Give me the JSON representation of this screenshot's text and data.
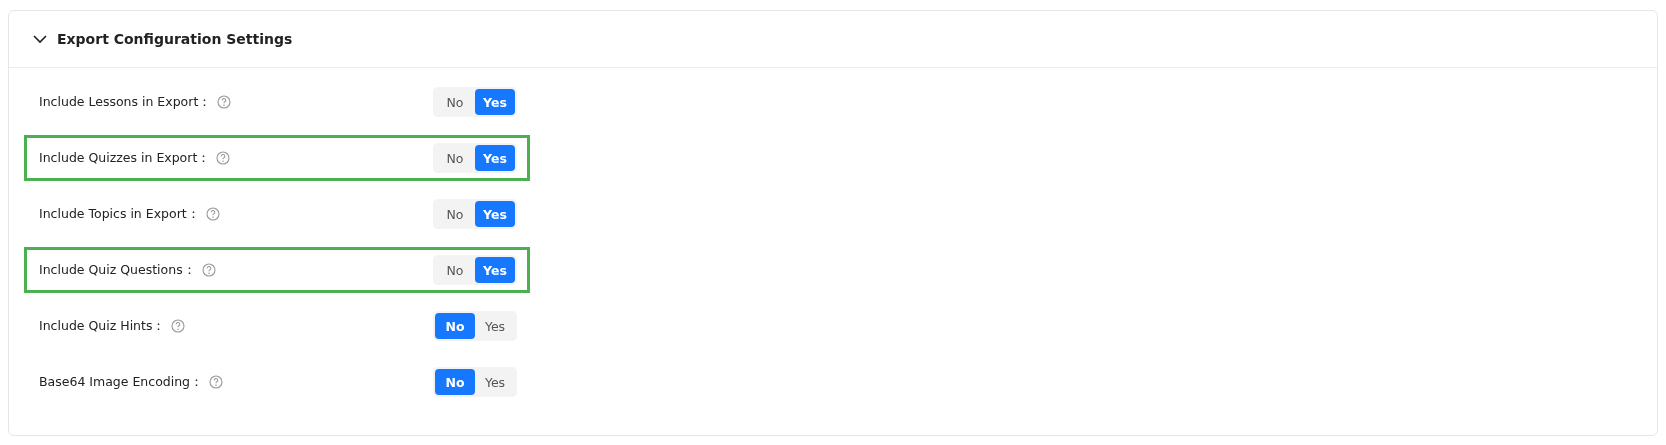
{
  "panel": {
    "title": "Export Configuration Settings",
    "expanded": true,
    "rows": [
      {
        "label": "Include Lessons in Export：",
        "highlighted": false,
        "options": [
          {
            "label": "No",
            "selected": false
          },
          {
            "label": "Yes",
            "selected": true
          }
        ]
      },
      {
        "label": "Include Quizzes in Export：",
        "highlighted": true,
        "options": [
          {
            "label": "No",
            "selected": false
          },
          {
            "label": "Yes",
            "selected": true
          }
        ]
      },
      {
        "label": "Include Topics in Export：",
        "highlighted": false,
        "options": [
          {
            "label": "No",
            "selected": false
          },
          {
            "label": "Yes",
            "selected": true
          }
        ]
      },
      {
        "label": "Include Quiz Questions：",
        "highlighted": true,
        "options": [
          {
            "label": "No",
            "selected": false
          },
          {
            "label": "Yes",
            "selected": true
          }
        ]
      },
      {
        "label": "Include Quiz Hints：",
        "highlighted": false,
        "options": [
          {
            "label": "No",
            "selected": true
          },
          {
            "label": "Yes",
            "selected": false
          }
        ]
      },
      {
        "label": "Base64 Image Encoding：",
        "highlighted": false,
        "options": [
          {
            "label": "No",
            "selected": true
          },
          {
            "label": "Yes",
            "selected": false
          }
        ]
      }
    ]
  }
}
